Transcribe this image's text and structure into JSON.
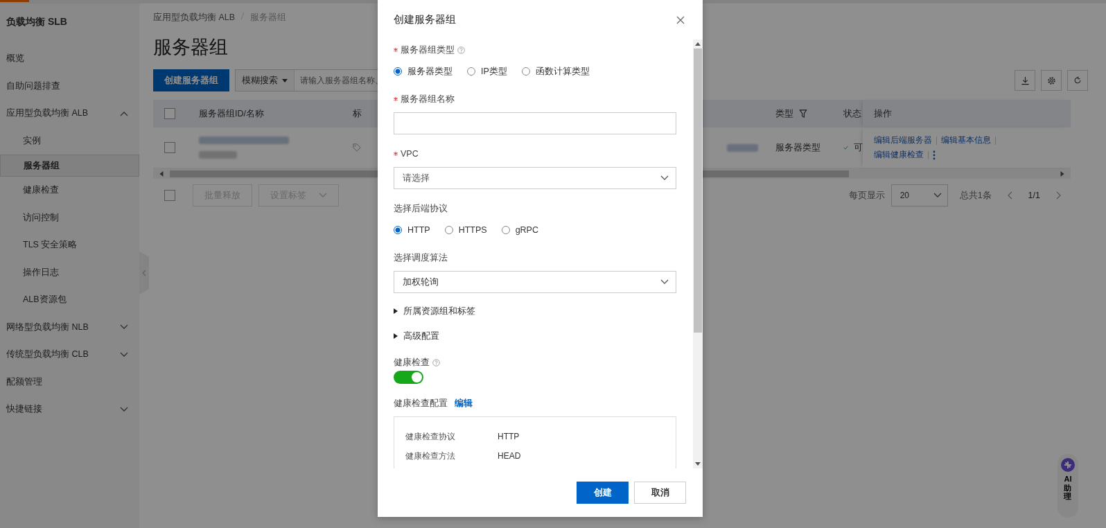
{
  "sidebar": {
    "title": "负载均衡 SLB",
    "items": [
      {
        "label": "概览",
        "selected": false
      },
      {
        "label": "自助问题排查",
        "selected": false
      },
      {
        "label": "应用型负载均衡 ALB",
        "selected": false,
        "expanded": true,
        "children": [
          {
            "label": "实例",
            "selected": false
          },
          {
            "label": "服务器组",
            "selected": true
          },
          {
            "label": "健康检查",
            "selected": false
          },
          {
            "label": "访问控制",
            "selected": false
          },
          {
            "label": "TLS 安全策略",
            "selected": false
          },
          {
            "label": "操作日志",
            "selected": false
          },
          {
            "label": "ALB资源包",
            "selected": false
          }
        ]
      },
      {
        "label": "网络型负载均衡 NLB",
        "selected": false,
        "expanded": false
      },
      {
        "label": "传统型负载均衡 CLB",
        "selected": false,
        "expanded": false
      },
      {
        "label": "配额管理",
        "selected": false
      },
      {
        "label": "快捷链接",
        "selected": false,
        "expanded": false
      }
    ]
  },
  "breadcrumb": [
    "应用型负载均衡 ALB",
    "服务器组"
  ],
  "page_title": "服务器组",
  "toolbar": {
    "create_button": "创建服务器组",
    "search_mode": "模糊搜索",
    "search": {
      "placeholder": "请输入服务器组名称、"
    }
  },
  "table": {
    "select_all": false,
    "columns": [
      {
        "label": "服务器组ID/名称",
        "filterable": false
      },
      {
        "label": "标",
        "filterable": false
      },
      {
        "label": "类型",
        "filterable": true
      },
      {
        "label": "状态",
        "filterable": false
      },
      {
        "label": "操作",
        "filterable": false
      }
    ],
    "rows": [
      {
        "selected": false,
        "type": "服务器类型",
        "status": "可",
        "actions": [
          "编辑后端服务器",
          "编辑基本信息",
          "编辑健康检查"
        ]
      }
    ]
  },
  "bulk_actions": {
    "checked": false,
    "buttons": [
      {
        "label": "批量释放",
        "disabled": true
      },
      {
        "label": "设置标签",
        "disabled": true
      }
    ]
  },
  "pagination": {
    "page_size_label": "每页显示",
    "page_size": "20",
    "total": "总共1条",
    "page": "1/1"
  },
  "modal": {
    "title": "创建服务器组",
    "fields": [
      {
        "kind": "radio",
        "label": "服务器组类型",
        "required": true,
        "help": true,
        "options": [
          {
            "label": "服务器类型",
            "selected": true
          },
          {
            "label": "IP类型",
            "selected": false
          },
          {
            "label": "函数计算类型",
            "selected": false
          }
        ]
      },
      {
        "kind": "input",
        "label": "服务器组名称",
        "required": true,
        "help": false
      },
      {
        "kind": "select",
        "label": "VPC",
        "required": true,
        "help": false,
        "placeholder": "请选择"
      },
      {
        "kind": "radio",
        "label": "选择后端协议",
        "required": false,
        "help": false,
        "options": [
          {
            "label": "HTTP",
            "selected": true
          },
          {
            "label": "HTTPS",
            "selected": false
          },
          {
            "label": "gRPC",
            "selected": false
          }
        ]
      },
      {
        "kind": "select",
        "label": "选择调度算法",
        "required": false,
        "help": false,
        "value": "加权轮询"
      },
      {
        "kind": "collapse",
        "label": "所属资源组和标签",
        "expanded": false
      },
      {
        "kind": "collapse",
        "label": "高级配置",
        "expanded": false
      },
      {
        "kind": "switch",
        "label": "健康检查",
        "required": false,
        "help": true,
        "on": true
      },
      {
        "kind": "summary",
        "label": "健康检查配置",
        "link": "编辑",
        "rows": [
          {
            "key": "健康检查协议",
            "value": "HTTP"
          },
          {
            "key": "健康检查方法",
            "value": "HEAD"
          }
        ]
      }
    ],
    "buttons": [
      {
        "label": "创建",
        "primary": true
      },
      {
        "label": "取消",
        "primary": false
      }
    ]
  },
  "ai_assistant": {
    "label": "AI助理"
  }
}
